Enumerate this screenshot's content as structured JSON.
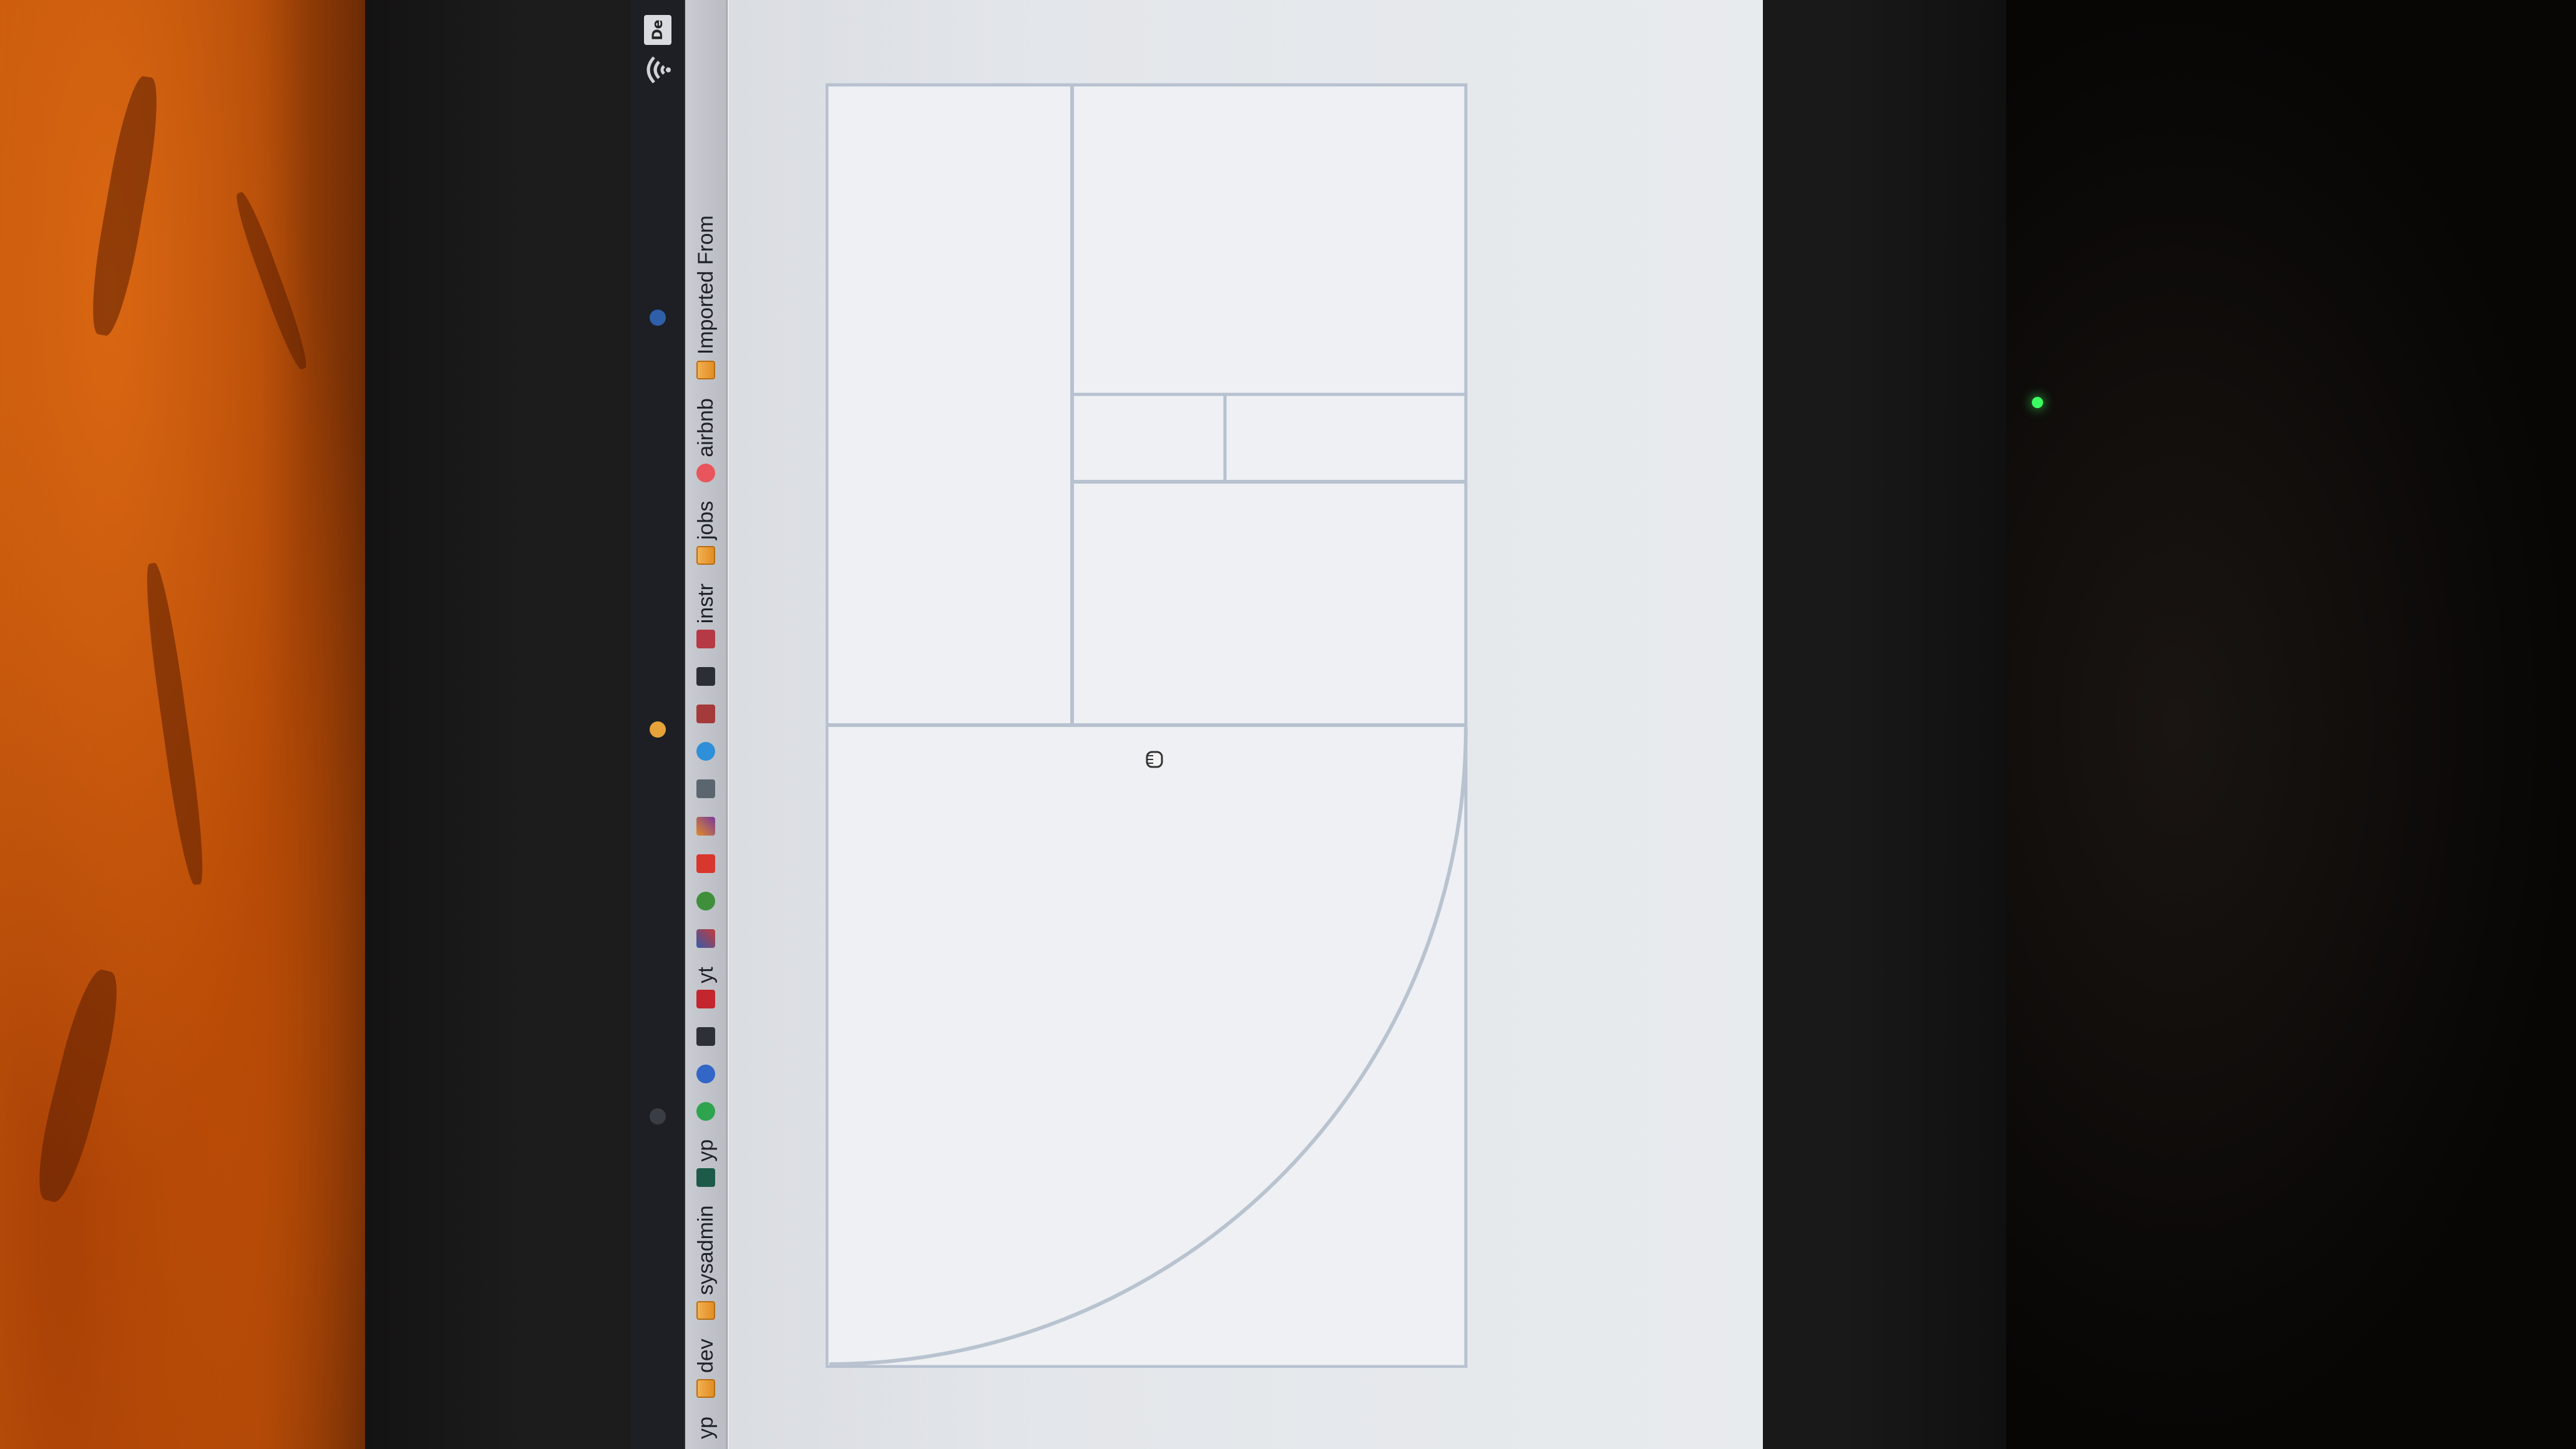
{
  "bookmarks": [
    {
      "label": "yp",
      "icon": "folder-icon"
    },
    {
      "label": "dev",
      "icon": "folder-icon"
    },
    {
      "label": "sysadmin",
      "icon": "folder-icon"
    },
    {
      "label": "yp",
      "icon": "site-icon"
    },
    {
      "label": "",
      "icon": "whatsapp-icon"
    },
    {
      "label": "",
      "icon": "location-icon"
    },
    {
      "label": "",
      "icon": "dark-site-icon"
    },
    {
      "label": "yt",
      "icon": "youtube-icon"
    },
    {
      "label": "",
      "icon": "tools-icon"
    },
    {
      "label": "",
      "icon": "green-globe-icon"
    },
    {
      "label": "",
      "icon": "gmail-icon"
    },
    {
      "label": "",
      "icon": "chart-icon"
    },
    {
      "label": "",
      "icon": "translate-icon"
    },
    {
      "label": "",
      "icon": "twitter-icon"
    },
    {
      "label": "",
      "icon": "app-icon"
    },
    {
      "label": "",
      "icon": "l-icon"
    },
    {
      "label": "instr",
      "icon": "puzzle-icon"
    },
    {
      "label": "jobs",
      "icon": "folder-icon"
    },
    {
      "label": "airbnb",
      "icon": "airbnb-icon"
    },
    {
      "label": "Imported From",
      "icon": "folder-icon"
    }
  ],
  "system_tray": {
    "badge": "De",
    "wifi": "wifi-icon"
  },
  "colors": {
    "bookmark_bar": "#c3c6cc",
    "page_background": "#e5e8ec",
    "line": "#b7c1cf",
    "folder": "#e8982f"
  }
}
